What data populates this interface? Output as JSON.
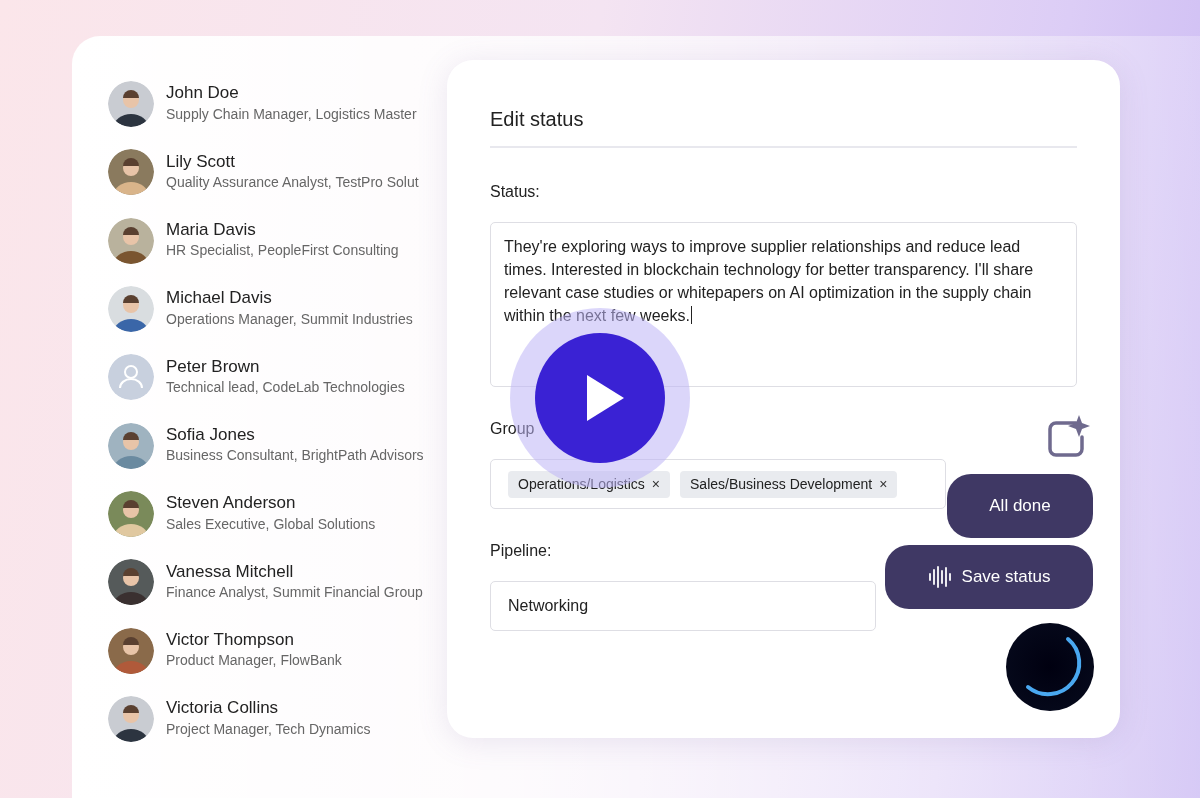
{
  "contacts": [
    {
      "name": "John Doe",
      "role": "Supply Chain Manager, Logistics Master",
      "kind": "picture"
    },
    {
      "name": "Lily Scott",
      "role": "Quality Assurance Analyst, TestPro Solut",
      "kind": "picture"
    },
    {
      "name": "Maria Davis",
      "role": "HR Specialist, PeopleFirst Consulting",
      "kind": "picture"
    },
    {
      "name": "Michael Davis",
      "role": "Operations Manager, Summit Industries",
      "kind": "picture"
    },
    {
      "name": "Peter Brown",
      "role": "Technical lead, CodeLab Technologies",
      "kind": "placeholder"
    },
    {
      "name": "Sofia Jones",
      "role": "Business Consultant, BrightPath Advisors",
      "kind": "picture"
    },
    {
      "name": "Steven Anderson",
      "role": "Sales Executive, Global Solutions",
      "kind": "picture"
    },
    {
      "name": "Vanessa Mitchell",
      "role": "Finance Analyst, Summit Financial Group",
      "kind": "picture"
    },
    {
      "name": "Victor Thompson",
      "role": "Product Manager, FlowBank",
      "kind": "picture"
    },
    {
      "name": "Victoria Collins",
      "role": "Project Manager, Tech Dynamics",
      "kind": "picture"
    }
  ],
  "dialog": {
    "title": "Edit status",
    "status": {
      "label": "Status:",
      "value": "They're exploring ways to improve supplier relationships and reduce lead times. Interested in blockchain technology for better transparency. I'll share relevant case studies or whitepapers on AI optimization in the supply chain within the next few weeks.",
      "focused": true
    },
    "groups": {
      "label": "Group",
      "tags": [
        {
          "label": "Operations/Logistics",
          "remove": "×"
        },
        {
          "label": "Sales/Business Development",
          "remove": "×"
        }
      ]
    },
    "pipeline": {
      "label": "Pipeline:",
      "value": "Networking"
    }
  },
  "actions": [
    {
      "label": "All done",
      "kind": "plain"
    },
    {
      "label": "Save status",
      "kind": "voice"
    }
  ]
}
